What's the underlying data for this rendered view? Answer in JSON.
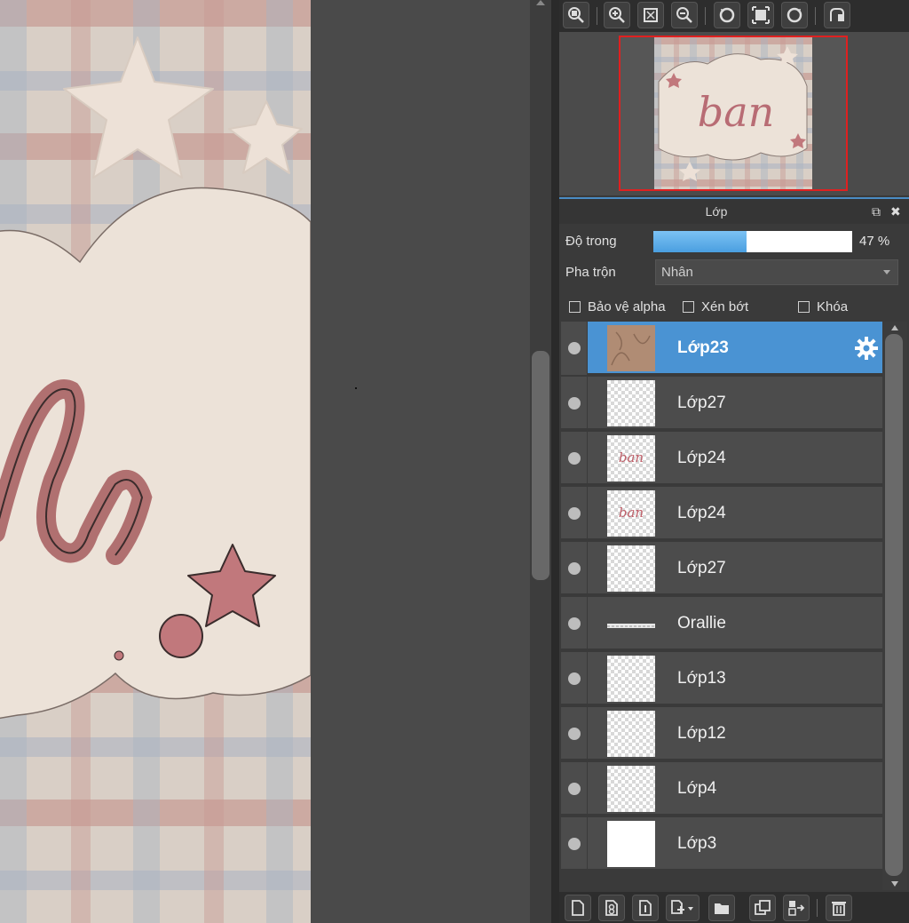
{
  "nav_toolbar": {
    "buttons": [
      "zoom-fit-icon",
      "zoom-in-icon",
      "fit-window-icon",
      "zoom-out-icon",
      "rotate-left-icon",
      "actual-size-icon",
      "rotate-right-icon",
      "flip-icon"
    ]
  },
  "navigator": {
    "preview_text": "ban"
  },
  "layer_panel": {
    "title": "Lớp",
    "opacity_label": "Độ trong",
    "opacity_value": "47 %",
    "opacity_fraction": 0.47,
    "blend_label": "Pha trộn",
    "blend_mode": "Nhân",
    "protect_alpha": "Bảo vệ alpha",
    "clipping": "Xén bớt",
    "lock": "Khóa"
  },
  "layers": [
    {
      "name": "Lớp23",
      "thumb": "brown",
      "selected": true
    },
    {
      "name": "Lớp27",
      "thumb": "checker"
    },
    {
      "name": "Lớp24",
      "thumb": "ban",
      "thumb_text": "ban"
    },
    {
      "name": "Lớp24",
      "thumb": "ban",
      "thumb_text": "ban"
    },
    {
      "name": "Lớp27",
      "thumb": "checker"
    },
    {
      "name": "Orallie",
      "thumb": "wide"
    },
    {
      "name": "Lớp13",
      "thumb": "checker"
    },
    {
      "name": "Lớp12",
      "thumb": "checker"
    },
    {
      "name": "Lớp4",
      "thumb": "checker"
    },
    {
      "name": "Lớp3",
      "thumb": "white"
    }
  ],
  "colors": {
    "accent": "#4a93d3",
    "navigator_frame": "#e02020"
  }
}
